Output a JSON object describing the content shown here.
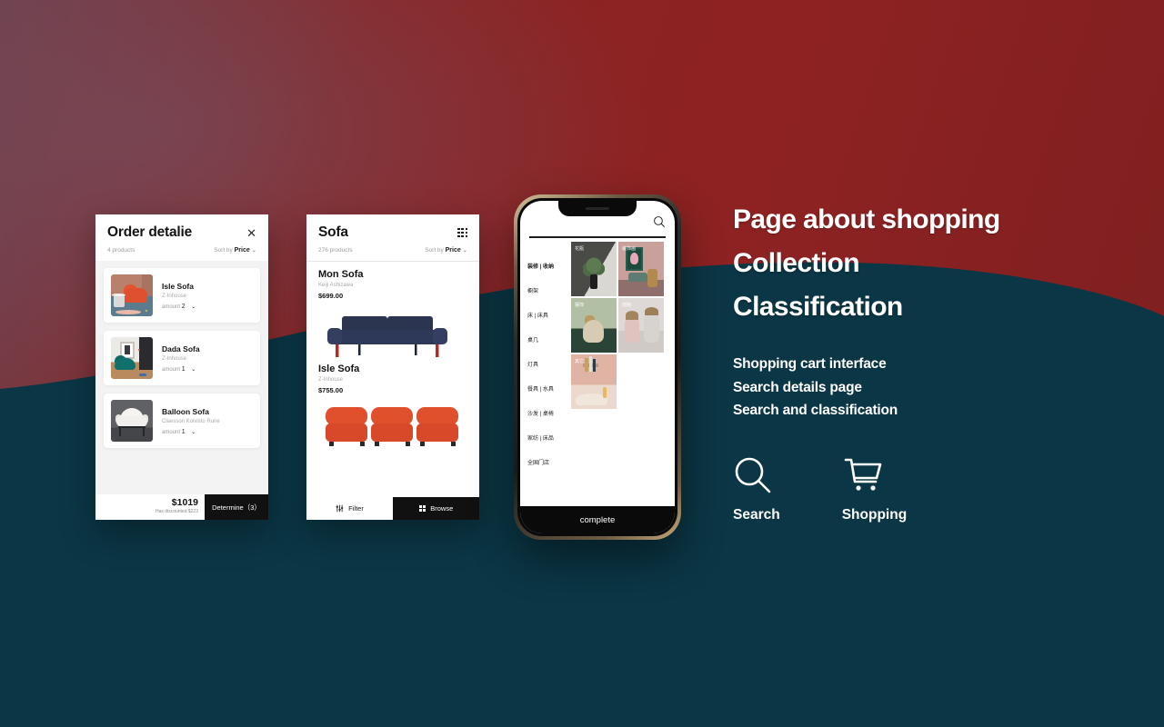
{
  "background": {
    "top_color": "#8b2424",
    "bottom_color": "#0b3645",
    "accent_plum": "#6b4250"
  },
  "order_card": {
    "title": "Order detalie",
    "close_icon": "close-icon",
    "product_count": "4 products",
    "sort_prefix": "Sort by",
    "sort_value": "Price",
    "sort_chevron": "⌄",
    "products": [
      {
        "name": "Isle Sofa",
        "brand": "Z-Inhouse",
        "amount_label": "amount",
        "amount": "2",
        "chevron": "⌄"
      },
      {
        "name": "Dada Sofa",
        "brand": "Z-Inhouse",
        "amount_label": "amount",
        "amount": "1",
        "chevron": "⌄"
      },
      {
        "name": "Balloon Sofa",
        "brand": "Claesson Koivisto Rune",
        "amount_label": "amount",
        "amount": "1",
        "chevron": "⌄"
      }
    ],
    "total_price": "$1019",
    "discount_note": "Has discounted $223",
    "determine_label": "Determine（3）"
  },
  "sofa_card": {
    "title": "Sofa",
    "grid_icon": "grid-view-icon",
    "product_count": "276 products",
    "sort_prefix": "Sort by",
    "sort_value": "Price",
    "sort_chevron": "⌄",
    "products": [
      {
        "name": "Mon Sofa",
        "brand": "Keiji Ashizawa",
        "price": "$699.00"
      },
      {
        "name": "Isle Sofa",
        "brand": "Z-Inhouse",
        "price": "$755.00"
      }
    ],
    "filter_label": "Filter",
    "filter_icon": "sliders-icon",
    "browse_label": "Browse",
    "browse_icon": "grid-squares-icon"
  },
  "phone": {
    "search_icon": "search-icon",
    "menu": [
      "装修 | 收纳",
      "橱架",
      "床 | 床具",
      "桌几",
      "灯具",
      "餐具 | 水具",
      "沙发 | 桌椅",
      "家纺 | 床品",
      "全国门店"
    ],
    "tiles": [
      {
        "label": "花瓶",
        "art": "t-vase"
      },
      {
        "label": "装饰画",
        "art": "t-art"
      },
      {
        "label": "摆饰",
        "art": "t-deco"
      },
      {
        "label": "储物",
        "art": "t-store"
      },
      {
        "label": "其它",
        "art": "t-other"
      }
    ],
    "bottom_label": "complete"
  },
  "copy": {
    "headline_line1": "Page about shopping",
    "headline_line2": "Collection",
    "headline_line3": "Classification",
    "sub_line1": "Shopping cart interface",
    "sub_line2": "Search details page",
    "sub_line3": "Search and classification",
    "features": [
      {
        "icon": "search-icon",
        "label": "Search"
      },
      {
        "icon": "shopping-cart-icon",
        "label": "Shopping"
      }
    ]
  }
}
